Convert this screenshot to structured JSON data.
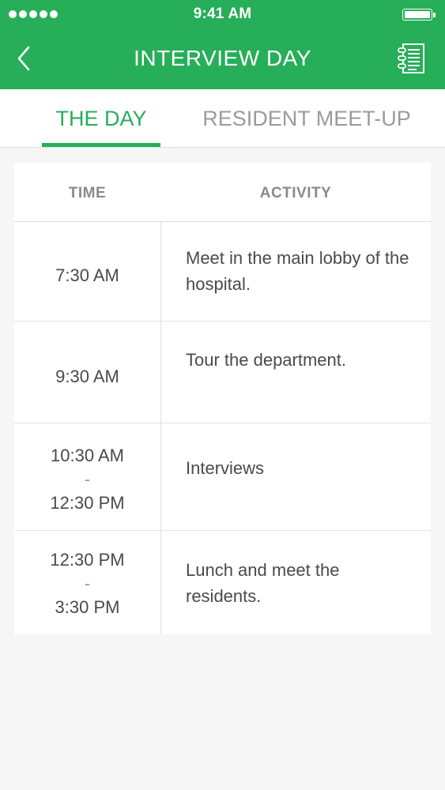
{
  "status_bar": {
    "time": "9:41 AM"
  },
  "nav": {
    "title": "INTERVIEW DAY"
  },
  "tabs": [
    {
      "label": "THE DAY",
      "active": true
    },
    {
      "label": "RESIDENT MEET-UP",
      "active": false
    }
  ],
  "table": {
    "headers": {
      "time": "TIME",
      "activity": "ACTIVITY"
    },
    "rows": [
      {
        "time_start": "7:30 AM",
        "separator": "",
        "time_end": "",
        "activity": "Meet in the main lobby of the hospital."
      },
      {
        "time_start": "9:30 AM",
        "separator": "",
        "time_end": "",
        "activity": "Tour the department."
      },
      {
        "time_start": "10:30 AM",
        "separator": "-",
        "time_end": "12:30 PM",
        "activity": "Interviews"
      },
      {
        "time_start": "12:30 PM",
        "separator": "-",
        "time_end": "3:30 PM",
        "activity": "Lunch and meet the residents."
      }
    ]
  },
  "colors": {
    "accent": "#27ae58",
    "background": "#f6f6f6",
    "card": "#ffffff"
  },
  "icons": {
    "back": "chevron-left-icon",
    "document": "document-list-icon"
  }
}
